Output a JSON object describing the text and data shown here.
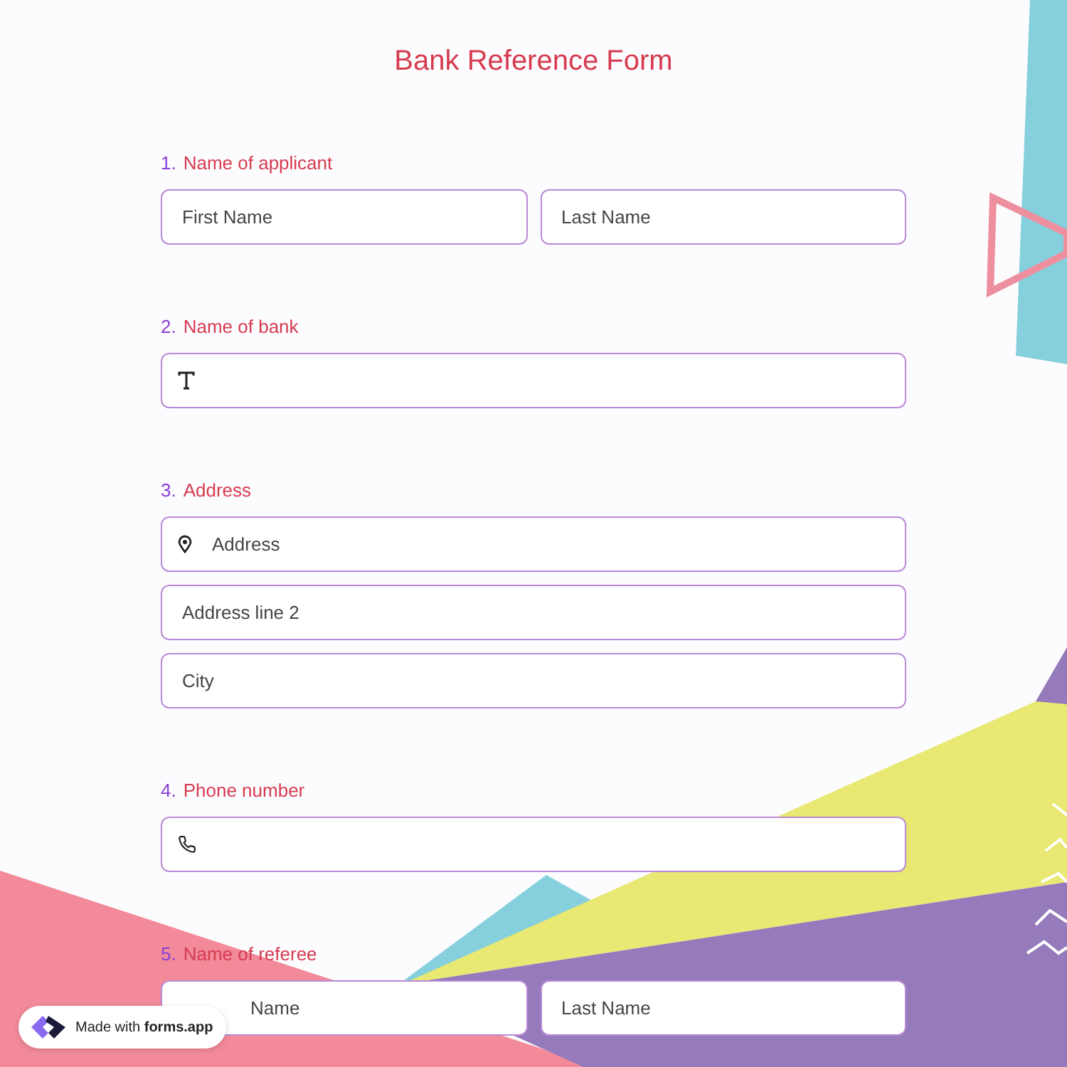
{
  "title": "Bank Reference Form",
  "questions": [
    {
      "number": "1.",
      "label": "Name of applicant",
      "rows": [
        [
          {
            "kind": "plain",
            "placeholder": "First Name"
          },
          {
            "kind": "plain",
            "placeholder": "Last Name"
          }
        ]
      ]
    },
    {
      "number": "2.",
      "label": "Name of bank",
      "rows": [
        [
          {
            "kind": "text"
          }
        ]
      ]
    },
    {
      "number": "3.",
      "label": "Address",
      "rows": [
        [
          {
            "kind": "location",
            "placeholder": "Address"
          }
        ],
        [
          {
            "kind": "plain",
            "placeholder": "Address line 2"
          }
        ],
        [
          {
            "kind": "plain",
            "placeholder": "City"
          }
        ]
      ]
    },
    {
      "number": "4.",
      "label": "Phone number",
      "rows": [
        [
          {
            "kind": "phone"
          }
        ]
      ]
    },
    {
      "number": "5.",
      "label": "Name of referee",
      "rows": [
        [
          {
            "kind": "plain",
            "placeholder": "Name",
            "covered": true
          },
          {
            "kind": "plain",
            "placeholder": "Last Name"
          }
        ]
      ]
    }
  ],
  "badge": "Made with **forms.app**"
}
